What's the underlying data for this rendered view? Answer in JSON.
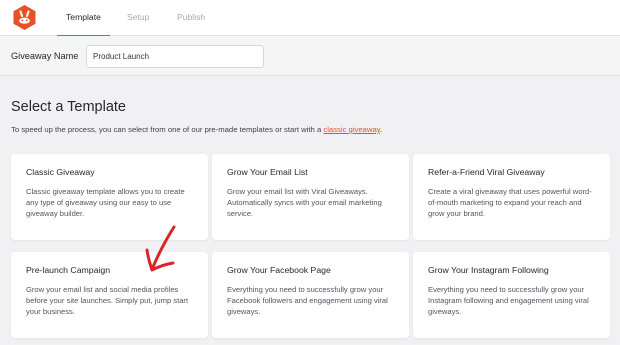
{
  "tabs": [
    "Template",
    "Setup",
    "Publish"
  ],
  "giveaway_name": {
    "label": "Giveaway Name",
    "value": "Product Launch"
  },
  "section": {
    "title": "Select a Template",
    "subtitle_before": "To speed up the process, you can select from one of our pre-made templates or start with a ",
    "subtitle_link": "classic giveaway",
    "subtitle_after": "."
  },
  "templates": [
    {
      "title": "Classic Giveaway",
      "desc": "Classic giveaway template allows you to create any type of giveaway using our easy to use giveaway builder."
    },
    {
      "title": "Grow Your Email List",
      "desc": "Grow your email list with Viral Giveaways. Automatically syncs with your email marketing service."
    },
    {
      "title": "Refer-a-Friend Viral Giveaway",
      "desc": "Create a viral giveaway that uses powerful word-of-mouth marketing to expand your reach and grow your brand."
    },
    {
      "title": "Pre-launch Campaign",
      "desc": "Grow your email list and social media profiles before your site launches. Simply put, jump start your business."
    },
    {
      "title": "Grow Your Facebook Page",
      "desc": "Everything you need to successfully grow your Facebook followers and engagement using viral giveways."
    },
    {
      "title": "Grow Your Instagram Following",
      "desc": "Everything you need to successfully grow your Instagram following and engagement using viral giveways."
    }
  ],
  "colors": {
    "accent": "#e45227",
    "annotation_arrow": "#d7262a"
  },
  "icons": {
    "logo": "rafflepress-bunny-logo",
    "annotation": "hand-drawn-arrow"
  }
}
